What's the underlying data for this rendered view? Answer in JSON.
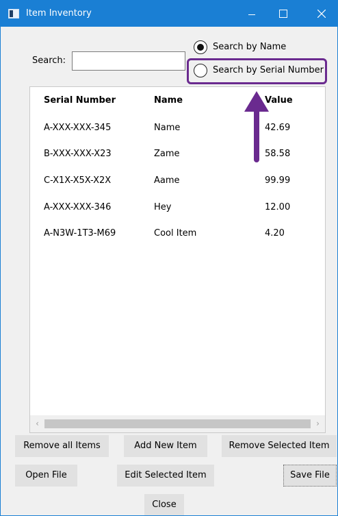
{
  "window": {
    "title": "Item Inventory"
  },
  "search": {
    "label": "Search:",
    "value": "",
    "placeholder": "",
    "options": [
      {
        "label": "Search by Name",
        "selected": true
      },
      {
        "label": "Search by Serial Number",
        "selected": false
      }
    ]
  },
  "table": {
    "columns": [
      "Serial Number",
      "Name",
      "Value"
    ],
    "rows": [
      {
        "serial": "A-XXX-XXX-345",
        "name": "Name",
        "value": "42.69"
      },
      {
        "serial": "B-XXX-XXX-X23",
        "name": "Zame",
        "value": "58.58"
      },
      {
        "serial": "C-X1X-X5X-X2X",
        "name": "Aame",
        "value": "99.99"
      },
      {
        "serial": "A-XXX-XXX-346",
        "name": "Hey",
        "value": "12.00"
      },
      {
        "serial": "A-N3W-1T3-M69",
        "name": "Cool Item",
        "value": "4.20"
      }
    ]
  },
  "buttons": {
    "remove_all": "Remove all Items",
    "add_new": "Add New Item",
    "remove_selected": "Remove Selected Item",
    "open_file": "Open File",
    "edit_selected": "Edit Selected Item",
    "save_file": "Save File",
    "close": "Close"
  },
  "icons": {
    "app": "window-app-icon",
    "minimize": "minimize-icon",
    "maximize": "maximize-icon",
    "close": "close-icon",
    "scroll_left": "chevron-left-icon",
    "scroll_right": "chevron-right-icon"
  },
  "colors": {
    "titlebar": "#1a7fd4",
    "highlight": "#6a2a8f",
    "arrow": "#6a2a8f"
  }
}
